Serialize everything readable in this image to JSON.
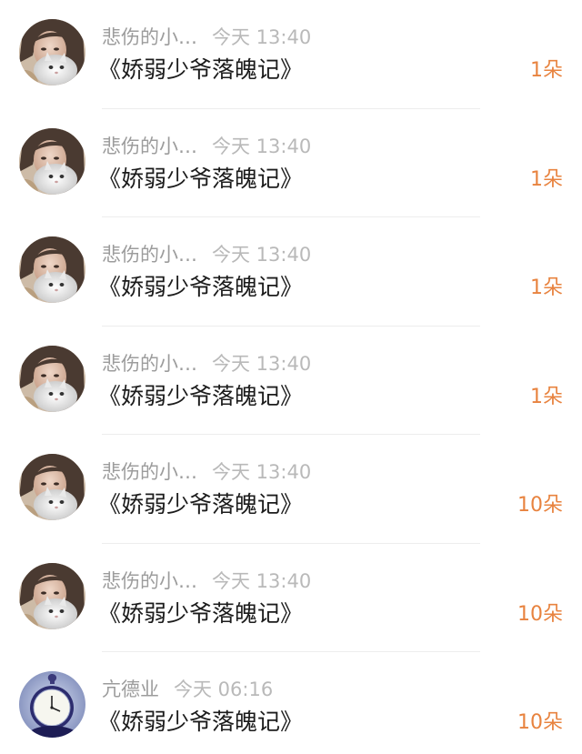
{
  "items": [
    {
      "name": "悲伤的小…",
      "time": "今天 13:40",
      "title": "《娇弱少爷落魄记》",
      "count": "1朵",
      "avatar": "girl-with-cat-avatar"
    },
    {
      "name": "悲伤的小…",
      "time": "今天 13:40",
      "title": "《娇弱少爷落魄记》",
      "count": "1朵",
      "avatar": "girl-with-cat-avatar"
    },
    {
      "name": "悲伤的小…",
      "time": "今天 13:40",
      "title": "《娇弱少爷落魄记》",
      "count": "1朵",
      "avatar": "girl-with-cat-avatar"
    },
    {
      "name": "悲伤的小…",
      "time": "今天 13:40",
      "title": "《娇弱少爷落魄记》",
      "count": "1朵",
      "avatar": "girl-with-cat-avatar"
    },
    {
      "name": "悲伤的小…",
      "time": "今天 13:40",
      "title": "《娇弱少爷落魄记》",
      "count": "10朵",
      "avatar": "girl-with-cat-avatar"
    },
    {
      "name": "悲伤的小…",
      "time": "今天 13:40",
      "title": "《娇弱少爷落魄记》",
      "count": "10朵",
      "avatar": "girl-with-cat-avatar"
    },
    {
      "name": "亢德业",
      "time": "今天 06:16",
      "title": "《娇弱少爷落魄记》",
      "count": "10朵",
      "avatar": "pocket-watch-avatar"
    }
  ],
  "colors": {
    "count": "#e8833f",
    "name": "#9c9c9c",
    "time": "#b9b9b9",
    "title": "#1c1c1c",
    "divider": "#ededed"
  }
}
